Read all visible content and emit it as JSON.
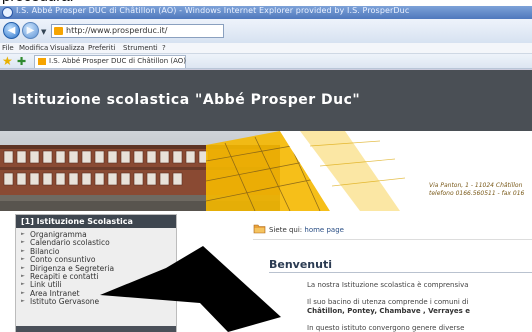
{
  "page_top_caption": "procedura:",
  "window": {
    "title": "I.S. Abbé Prosper DUC di Châtillon (AO) - Windows Internet Explorer provided by I.S. ProsperDuc"
  },
  "navigation": {
    "back_glyph": "◀",
    "forward_glyph": "▶",
    "dropdown_glyph": "▼",
    "url": "http://www.prosperduc.it/"
  },
  "menu": {
    "items": [
      "File",
      "Modifica",
      "Visualizza",
      "Preferiti",
      "Strumenti",
      "?"
    ]
  },
  "favorites": {
    "star_glyph": "★",
    "add_glyph": "✚",
    "tab_label": "I.S. Abbé Prosper DUC di Châtillon (AO)"
  },
  "site": {
    "title": "Istituzione scolastica \"Abbé Prosper Duc\"",
    "address": "Via Panton, 1 - 11024 Châtillon",
    "phone": "telefono 0166.560511 - fax 016"
  },
  "sidebar": {
    "heading": "[1] Istituzione Scolastica",
    "arrow_glyph": "►",
    "items": [
      "Organigramma",
      "Calendario scolastico",
      "Bilancio",
      "Conto consuntivo",
      "Dirigenza e Segreteria",
      "Recapiti e contatti",
      "Link utili",
      "Area Intranet",
      "Istituto Gervasone"
    ]
  },
  "content": {
    "breadcrumb_prefix": "Siete qui:",
    "breadcrumb_link": "home page",
    "heading": "Benvenuti",
    "paragraph1": "La nostra Istituzione scolastica è comprensiva",
    "paragraph2": "Il suo bacino di utenza comprende i comuni di",
    "paragraph2_bold": "Châtillon, Pontey, Chambave , Verrayes e",
    "paragraph3": "In questo istituto convergono genere diverse"
  },
  "colors": {
    "header_bg": "#4a4f55",
    "sidebar_head_bg": "#3e464f",
    "banner_yellow": "#f5b800",
    "arrow": "#000000"
  }
}
